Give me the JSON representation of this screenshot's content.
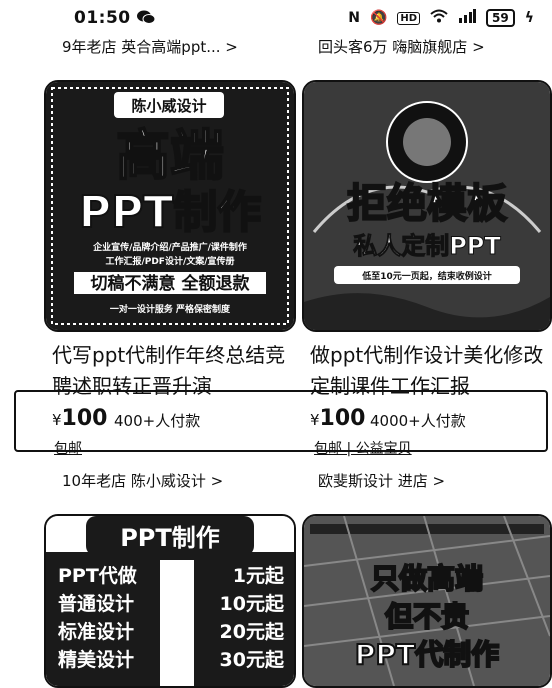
{
  "status": {
    "time": "01:50",
    "battery": "59"
  },
  "row1": {
    "left_store": "9年老店 英合高端ppt... >",
    "right_store": "回头客6万 嗨脑旗舰店 >"
  },
  "card1": {
    "badge": "陈小威设计",
    "line1": "高端",
    "line2": "PPT制作",
    "services1": "企业宣传/品牌介绍/产品推广/课件制作",
    "services2": "工作汇报/PDF设计/文案/宣传册",
    "guarantee": "切稿不满意 全额退款",
    "footer": "一对一设计服务  严格保密制度",
    "title": "代写ppt代制作年终总结竞聘述职转正晋升演",
    "price_symbol": "¥",
    "price": "100",
    "paid": "400+人付款",
    "tags": "包邮"
  },
  "card2": {
    "headline": "拒绝模板",
    "subline": "私人定制PPT",
    "note": "低至10元一页起，结束收例设计",
    "title": "做ppt代制作设计美化修改定制课件工作汇报",
    "price_symbol": "¥",
    "price": "100",
    "paid": "4000+人付款",
    "tags": "包邮 | 公益宝贝"
  },
  "row2": {
    "left_store": "10年老店 陈小威设计 >",
    "right_store": "欧斐斯设计 进店 >"
  },
  "card3": {
    "header": "PPT制作",
    "rows": [
      {
        "label": "PPT代做",
        "price": "1元起"
      },
      {
        "label": "普通设计",
        "price": "10元起"
      },
      {
        "label": "标准设计",
        "price": "20元起"
      },
      {
        "label": "精美设计",
        "price": "30元起"
      }
    ]
  },
  "card4": {
    "line1": "只做高端",
    "line2": "但不贵",
    "line3": "PPT代制作"
  }
}
